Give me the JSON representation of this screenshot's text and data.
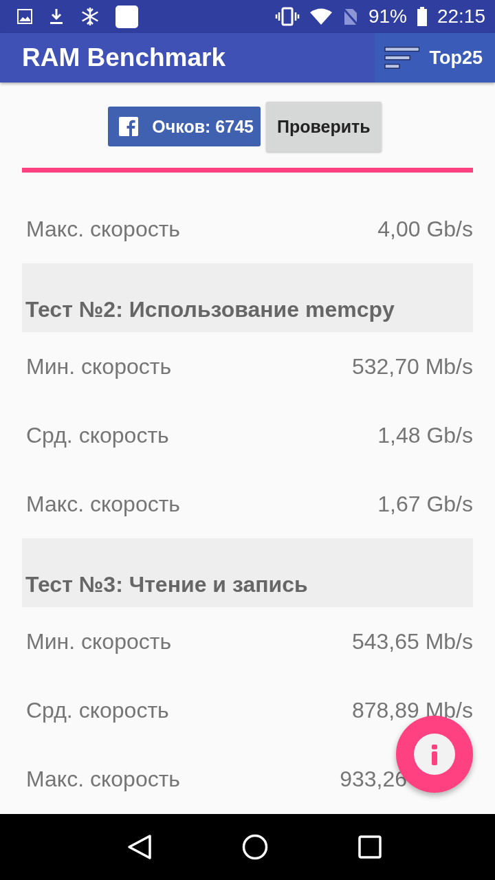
{
  "status_bar": {
    "battery": "91%",
    "time": "22:15"
  },
  "app_bar": {
    "title": "RAM Benchmark",
    "action": "Top25"
  },
  "score_button": "Очков: 6745",
  "check_button": "Проверить",
  "results": [
    {
      "kind": "row",
      "label": "Макс. скорость",
      "value": "4,00 Gb/s"
    },
    {
      "kind": "header",
      "label": "Тест №2: Использование memcpy"
    },
    {
      "kind": "row",
      "label": "Мин. скорость",
      "value": "532,70 Mb/s"
    },
    {
      "kind": "row",
      "label": "Срд. скорость",
      "value": "1,48 Gb/s"
    },
    {
      "kind": "row",
      "label": "Макс. скорость",
      "value": "1,67 Gb/s"
    },
    {
      "kind": "header",
      "label": "Тест №3: Чтение и запись"
    },
    {
      "kind": "row",
      "label": "Мин. скорость",
      "value": "543,65 Mb/s"
    },
    {
      "kind": "row",
      "label": "Срд. скорость",
      "value": "878,89 Mb/s"
    },
    {
      "kind": "row",
      "label": "Макс. скорость",
      "value": "933,26"
    }
  ]
}
